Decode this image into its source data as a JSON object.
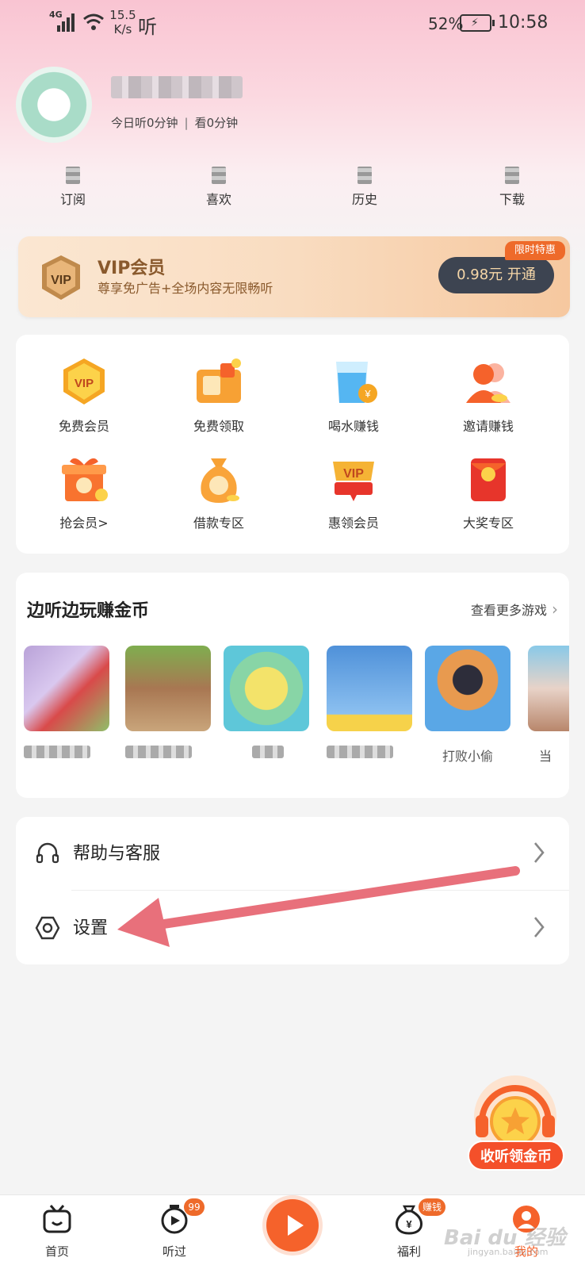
{
  "status_bar": {
    "network": "4G",
    "speed_value": "15.5",
    "speed_unit": "K/s",
    "app_glyph": "听",
    "battery": "52%",
    "time": "10:58"
  },
  "profile": {
    "listen_today": "今日听0分钟",
    "read_today": "看0分钟"
  },
  "quick_row": {
    "items": [
      {
        "label": "订阅",
        "icon": "subscribe-icon"
      },
      {
        "label": "喜欢",
        "icon": "like-icon"
      },
      {
        "label": "历史",
        "icon": "history-icon"
      },
      {
        "label": "下载",
        "icon": "download-icon"
      }
    ]
  },
  "vip_banner": {
    "title": "VIP会员",
    "subtitle": "尊享免广告+全场内容无限畅听",
    "button": "0.98元 开通",
    "badge": "限时特惠",
    "icon": "vip-shield-icon"
  },
  "grid": {
    "items": [
      {
        "label": "免费会员",
        "icon": "vip-badge-icon"
      },
      {
        "label": "免费领取",
        "icon": "wallet-icon"
      },
      {
        "label": "喝水赚钱",
        "icon": "water-glass-icon"
      },
      {
        "label": "邀请赚钱",
        "icon": "invite-icon"
      },
      {
        "label": "抢会员>",
        "icon": "gift-icon"
      },
      {
        "label": "借款专区",
        "icon": "money-bag-icon"
      },
      {
        "label": "惠领会员",
        "icon": "vip-ribbon-icon"
      },
      {
        "label": "大奖专区",
        "icon": "red-envelope-icon"
      }
    ]
  },
  "games": {
    "title": "边听边玩赚金币",
    "more": "查看更多游戏",
    "items": [
      {
        "name": "",
        "colors": [
          "#b9a2d8",
          "#d94a4a",
          "#8fbf6a"
        ]
      },
      {
        "name": "",
        "colors": [
          "#7fae4f",
          "#a87752",
          "#c9a57b"
        ]
      },
      {
        "name": "",
        "colors": [
          "#5ec7d9",
          "#f3e36a",
          "#88d5a6"
        ]
      },
      {
        "name": "",
        "colors": [
          "#4f91d9",
          "#8cc0f0",
          "#f6d24a"
        ]
      },
      {
        "name": "打败小偷",
        "colors": [
          "#5aa7e6",
          "#2d2d3a",
          "#e89a4f"
        ]
      },
      {
        "name": "当",
        "colors": [
          "#89c9e8",
          "#e8d3c8",
          "#b8866b"
        ]
      }
    ]
  },
  "menu": {
    "items": [
      {
        "label": "帮助与客服",
        "icon": "headset-icon"
      },
      {
        "label": "设置",
        "icon": "settings-icon"
      }
    ]
  },
  "floating_coin": {
    "label": "收听领金币"
  },
  "bottom_nav": {
    "items": [
      {
        "label": "首页",
        "icon": "tv-icon"
      },
      {
        "label": "听过",
        "icon": "timer-icon",
        "badge": "99"
      },
      {
        "label": "福利",
        "icon": "yen-bag-icon",
        "badge": "赚钱"
      },
      {
        "label": "我的",
        "icon": "profile-icon"
      }
    ]
  },
  "watermark": {
    "text": "Bai du 经验",
    "sub": "jingyan.baidu.com"
  },
  "colors": {
    "accent": "#f5622b",
    "vip_dark": "#3d4451",
    "annotation": "#e8707b"
  }
}
